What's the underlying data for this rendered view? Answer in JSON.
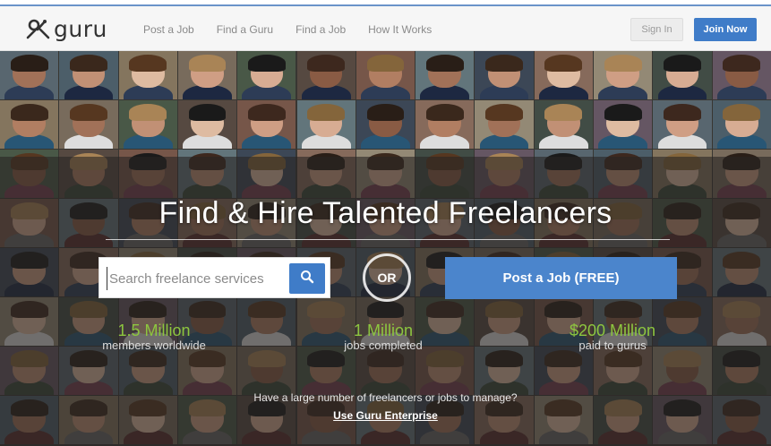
{
  "header": {
    "logo_text": "guru",
    "nav": [
      "Post a Job",
      "Find a Guru",
      "Find a Job",
      "How It Works"
    ],
    "signin_label": "Sign In",
    "join_label": "Join Now"
  },
  "hero": {
    "headline": "Find & Hire Talented Freelancers",
    "search": {
      "placeholder": "Search freelance services"
    },
    "or_label": "OR",
    "post_job_label": "Post a Job (FREE)",
    "stats": [
      {
        "number": "1.5 Million",
        "label": "members worldwide"
      },
      {
        "number": "1 Million",
        "label": "jobs completed"
      },
      {
        "number": "$200 Million",
        "label": "paid to gurus"
      }
    ],
    "enterprise_text": "Have a large number of freelancers or jobs to manage?",
    "enterprise_link": "Use Guru Enterprise"
  },
  "colors": {
    "accent_blue": "#3f7cc8",
    "stat_green": "#8dc63f",
    "top_line": "#6a93c9"
  },
  "icons": {
    "search_button": "search-icon",
    "logo": "guru-logo-icon"
  }
}
